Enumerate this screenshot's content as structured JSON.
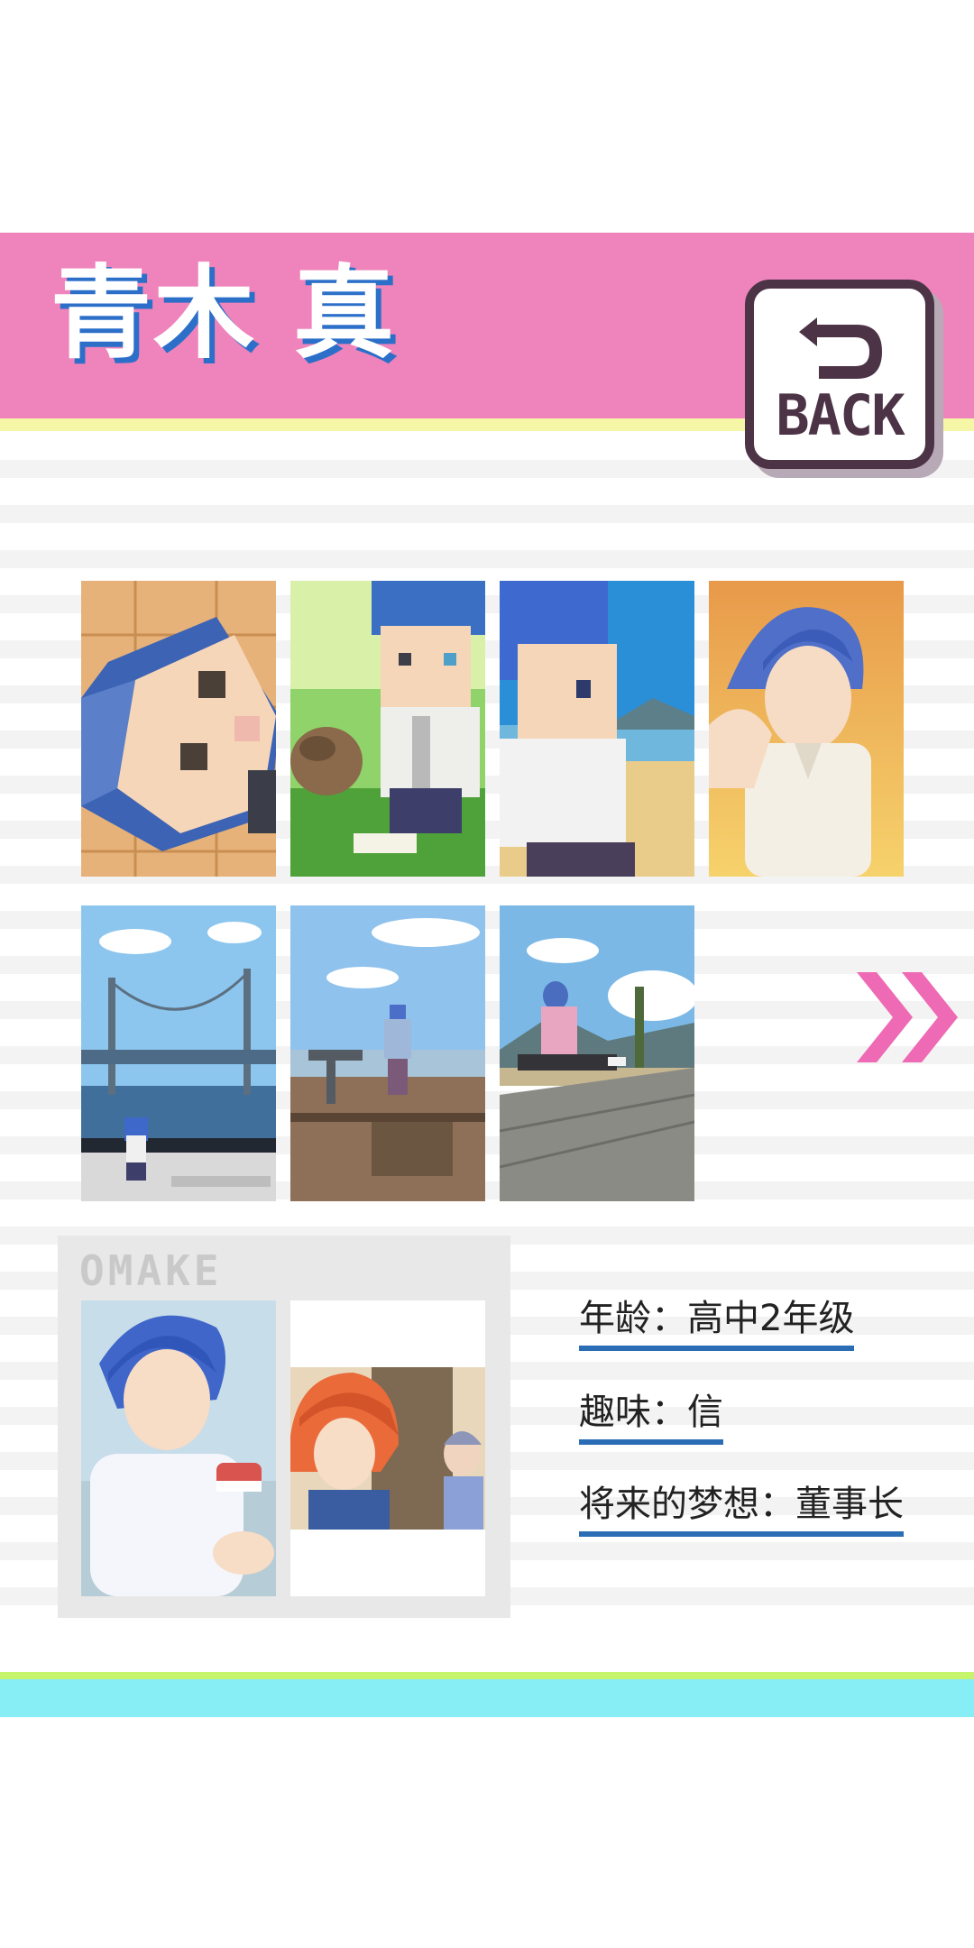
{
  "character": {
    "name": "青木 真"
  },
  "back_button": {
    "label": "BACK"
  },
  "gallery": {
    "items": [
      {
        "name": "gallery-pixel-face-closeup"
      },
      {
        "name": "gallery-pixel-boy-with-cat"
      },
      {
        "name": "gallery-pixel-boy-at-beach"
      },
      {
        "name": "gallery-anime-boy-sunset"
      },
      {
        "name": "gallery-pixel-boy-at-bridge"
      },
      {
        "name": "gallery-boy-at-lookout"
      },
      {
        "name": "gallery-boy-sitting-on-boardwalk"
      }
    ]
  },
  "omake": {
    "label": "OMAKE",
    "items": [
      {
        "name": "omake-boy-eating-sushi"
      },
      {
        "name": "omake-redhead-boy-with-family"
      }
    ]
  },
  "profile": {
    "age": "年龄：高中2年级",
    "hobby": "趣味：信",
    "dream": "将来的梦想：董事长"
  },
  "colors": {
    "title_band": "#ee84bb",
    "title_shadow": "#2c6fc9",
    "underline": "#2a6db5",
    "next_arrow": "#ee6ab4",
    "bottom_green": "#c6f46c",
    "bottom_cyan": "#86eef4"
  },
  "icons": {
    "back": "back-arrow-icon",
    "next": "double-chevron-right-icon"
  }
}
